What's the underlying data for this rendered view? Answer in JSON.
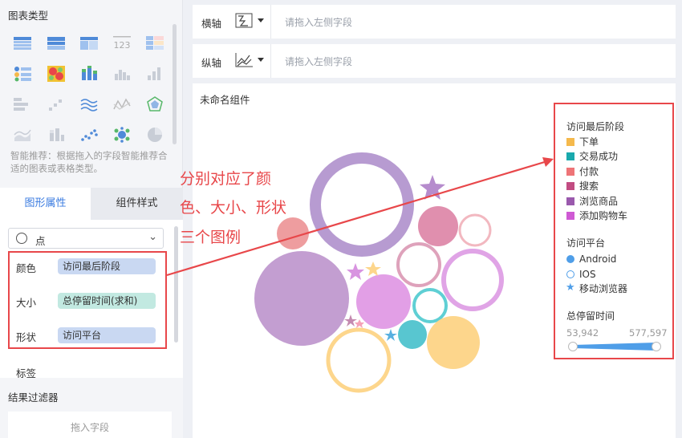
{
  "left_panel": {
    "chart_type_title": "图表类型",
    "hint": "智能推荐：根据拖入的字段智能推荐合适的图表或表格类型。",
    "chart_type_icons": [
      "table-icon",
      "cross-table-icon",
      "grouped-table-icon",
      "kpi-number-icon",
      "colored-table-icon",
      "list-card-icon",
      "heatmap-icon",
      "stacked-column-icon",
      "column-bar-icon",
      "bar-chart-icon",
      "horizontal-bar-icon",
      "scatter-step-icon",
      "multi-line-icon",
      "line-icon",
      "radar-icon",
      "area-icon",
      "stacked-bar-icon",
      "scatter-icon",
      "bubble-icon",
      "pie-icon"
    ],
    "tabs": {
      "graph_props": "图形属性",
      "component_style": "组件样式"
    },
    "shape_select": "点",
    "props": [
      {
        "label": "颜色",
        "value": "访问最后阶段"
      },
      {
        "label": "大小",
        "value": "总停留时间(求和)"
      },
      {
        "label": "形状",
        "value": "访问平台"
      }
    ],
    "tag_label": "标签",
    "filter_title": "结果过滤器",
    "drop_hint": "拖入字段"
  },
  "axes": {
    "x": {
      "label": "横轴",
      "placeholder": "请拖入左侧字段"
    },
    "y": {
      "label": "纵轴",
      "placeholder": "请拖入左侧字段"
    }
  },
  "widget": {
    "title": "未命名组件"
  },
  "annotation": {
    "line1": "分别对应了颜",
    "line2": "色、大小、形状",
    "line3": "三个图例"
  },
  "legend": {
    "color_title": "访问最后阶段",
    "color_items": [
      {
        "label": "下单",
        "color": "#f5b94c"
      },
      {
        "label": "交易成功",
        "color": "#1aa9ad"
      },
      {
        "label": "付款",
        "color": "#ee7477"
      },
      {
        "label": "搜索",
        "color": "#c24c82"
      },
      {
        "label": "浏览商品",
        "color": "#9a59ad"
      },
      {
        "label": "添加购物车",
        "color": "#cf5ad4"
      }
    ],
    "shape_title": "访问平台",
    "shape_items": [
      {
        "label": "Android",
        "shape": "filled-circle"
      },
      {
        "label": "IOS",
        "shape": "hollow-circle"
      },
      {
        "label": "移动浏览器",
        "shape": "star"
      }
    ],
    "size_title": "总停留时间",
    "size_min": "53,942",
    "size_max": "577,597"
  },
  "chart_data": {
    "type": "scatter",
    "encoding": {
      "color": "访问最后阶段",
      "size": "总停留时间",
      "shape": "访问平台"
    },
    "size_range": [
      53942,
      577597
    ]
  }
}
